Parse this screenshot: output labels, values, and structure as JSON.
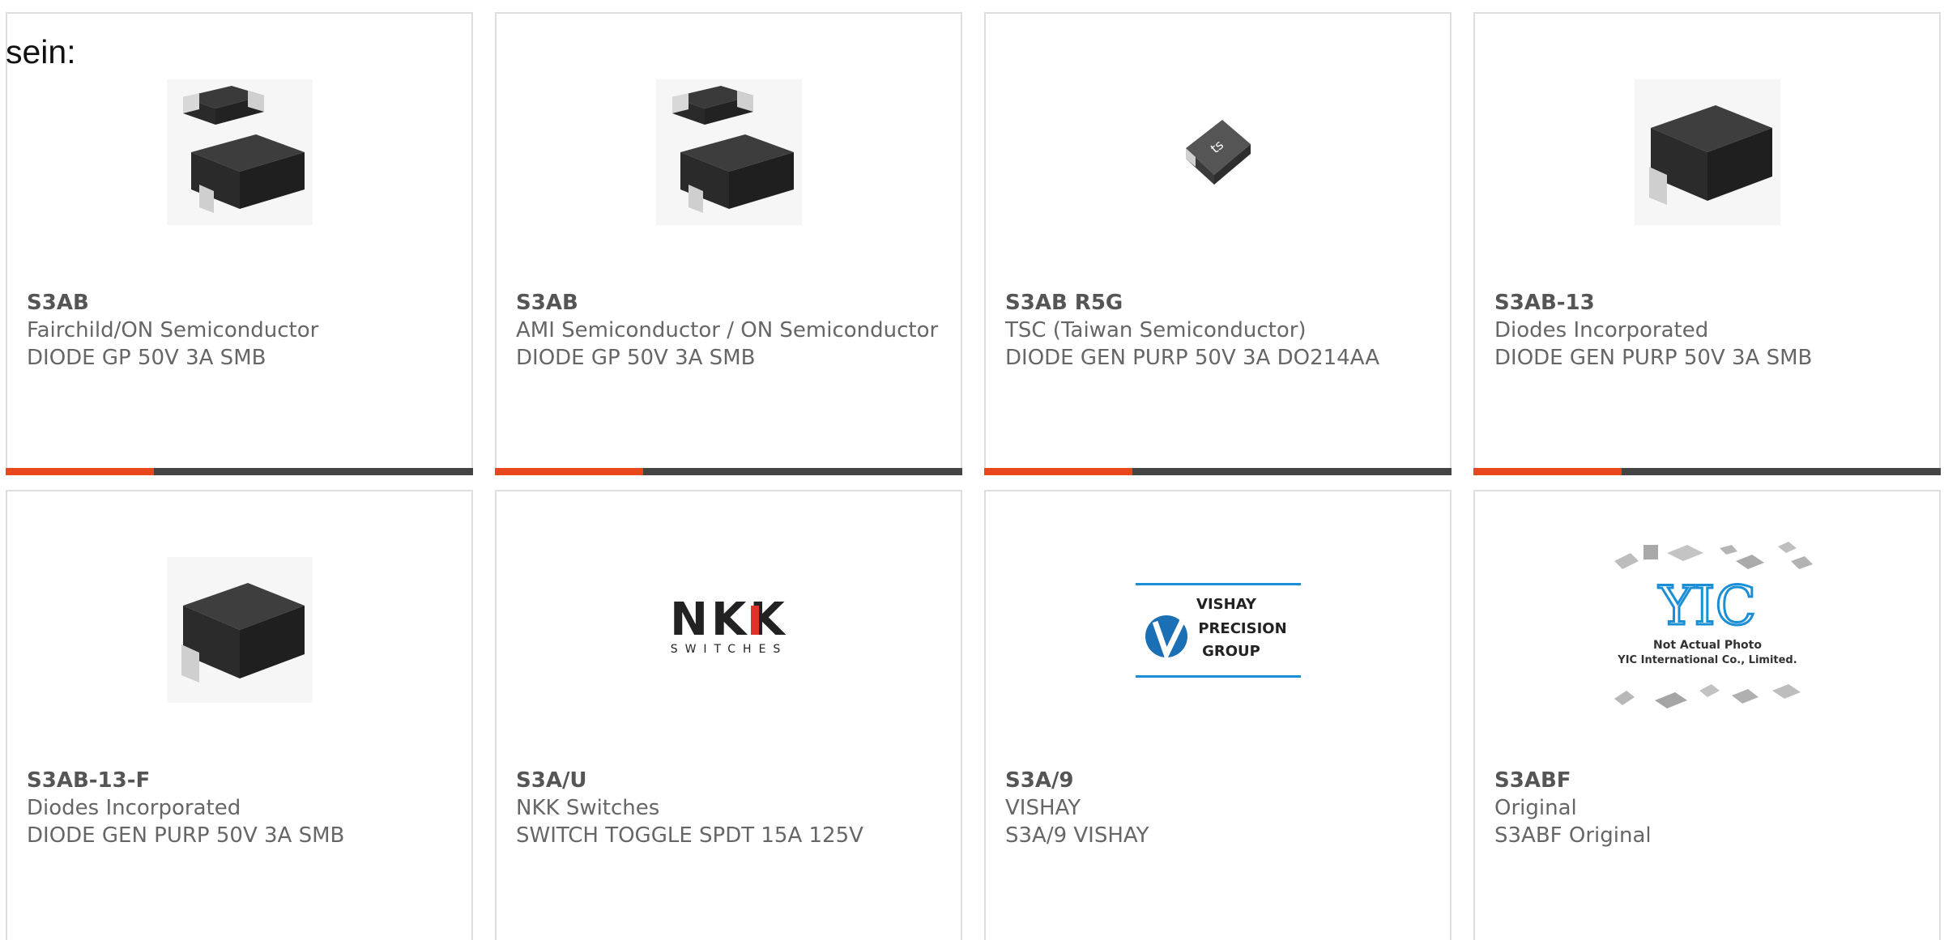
{
  "intro_text": "sein:",
  "colors": {
    "accent": "#e8461d",
    "bar_dark": "#444444",
    "card_border": "#dedede",
    "text": "#666666"
  },
  "products": [
    {
      "part": "S3AB",
      "manufacturer": "Fairchild/ON Semiconductor",
      "description": "DIODE GP 50V 3A SMB",
      "image": "smb-diode-pair-photo"
    },
    {
      "part": "S3AB",
      "manufacturer": "AMI Semiconductor / ON Semiconductor",
      "description": "DIODE GP 50V 3A SMB",
      "image": "smb-diode-pair-photo"
    },
    {
      "part": "S3AB R5G",
      "manufacturer": "TSC (Taiwan Semiconductor)",
      "description": "DIODE GEN PURP 50V 3A DO214AA",
      "image": "tsc-diode-photo"
    },
    {
      "part": "S3AB-13",
      "manufacturer": "Diodes Incorporated",
      "description": "DIODE GEN PURP 50V 3A SMB",
      "image": "smb-diode-photo"
    },
    {
      "part": "S3AB-13-F",
      "manufacturer": "Diodes Incorporated",
      "description": "DIODE GEN PURP 50V 3A SMB",
      "image": "smb-diode-photo"
    },
    {
      "part": "S3A/U",
      "manufacturer": "NKK Switches",
      "description": "SWITCH TOGGLE SPDT 15A 125V",
      "image": "nkk-logo",
      "logo_text": "NKK",
      "logo_sub": "SWITCHES"
    },
    {
      "part": "S3A/9",
      "manufacturer": "VISHAY",
      "description": "S3A/9 VISHAY",
      "image": "vishay-logo",
      "logo_lines": [
        "VISHAY",
        "PRECISION",
        "GROUP"
      ]
    },
    {
      "part": "S3ABF",
      "manufacturer": "Original",
      "description": "S3ABF Original",
      "image": "yic-placeholder",
      "logo_text": "YIC",
      "caption_lines": [
        "Not Actual Photo",
        "YIC International Co., Limited."
      ]
    }
  ]
}
